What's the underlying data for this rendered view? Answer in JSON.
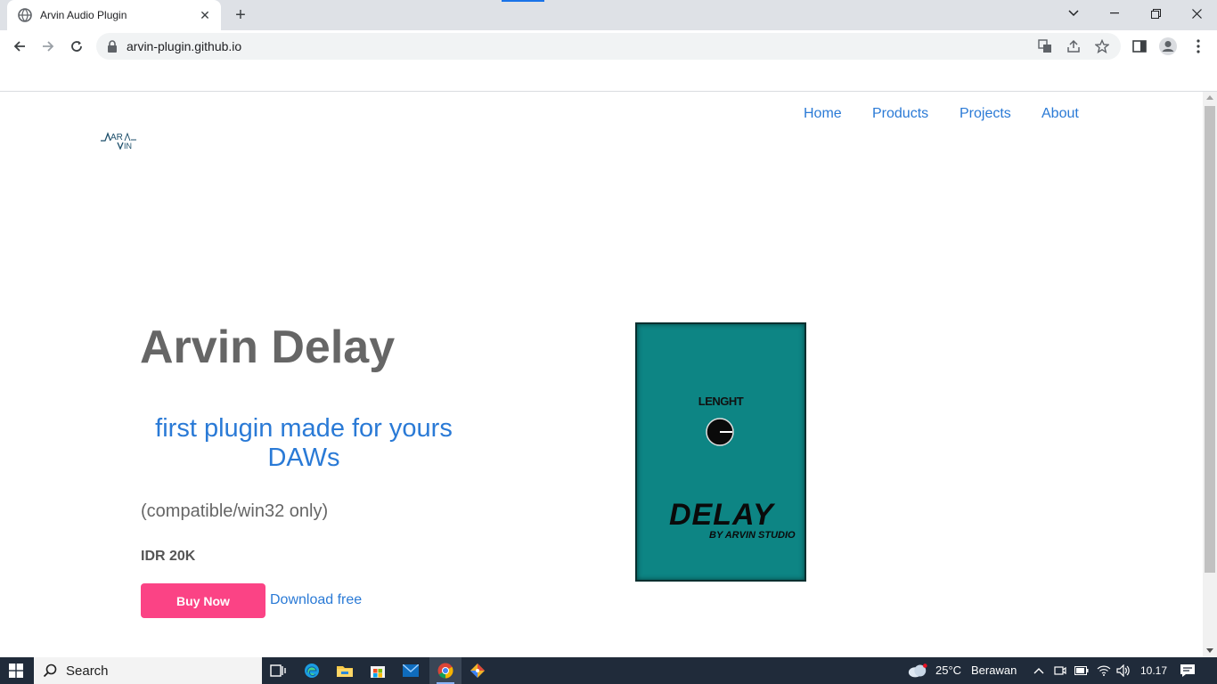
{
  "browser": {
    "tab_title": "Arvin Audio Plugin",
    "new_tab_label": "+",
    "url": "arvin-plugin.github.io"
  },
  "site": {
    "logo_text": "ARVIN",
    "nav": [
      "Home",
      "Products",
      "Projects",
      "About"
    ]
  },
  "hero": {
    "title": "Arvin Delay",
    "subtitle": "first plugin made for yours DAWs",
    "compat": "(compatible/win32 only)",
    "price": "IDR 20K",
    "buy_label": "Buy Now",
    "download_label": "Download free"
  },
  "plugin_image": {
    "knob_label": "LENGHT",
    "name": "DELAY",
    "byline": "BY ARVIN STUDIO",
    "bg_color": "#0d8584"
  },
  "taskbar": {
    "search_label": "Search",
    "weather_temp": "25°C",
    "weather_desc": "Berawan",
    "time": "10.17"
  },
  "colors": {
    "link": "#2a7ad6",
    "buy_button": "#fb4385",
    "heading": "#666666"
  }
}
